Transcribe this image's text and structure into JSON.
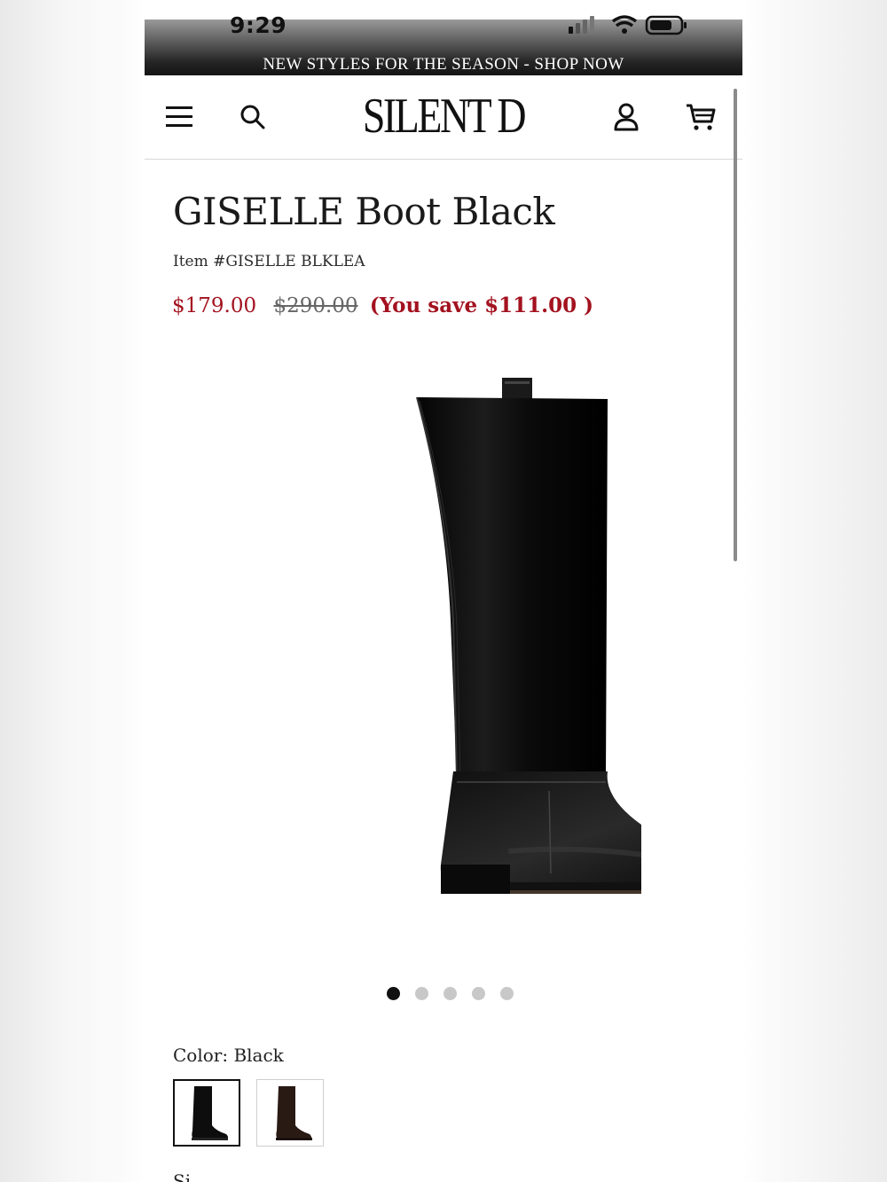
{
  "status_bar": {
    "time": "9:29"
  },
  "promo_banner": {
    "text": "NEW STYLES FOR THE SEASON - SHOP NOW"
  },
  "header": {
    "logo": "SILENT D",
    "icons": [
      "menu-icon",
      "search-icon",
      "account-icon",
      "cart-icon"
    ]
  },
  "product": {
    "title": "GISELLE Boot Black",
    "sku": "Item #GISELLE BLKLEA",
    "sale_price": "$179.00",
    "original_price": "$290.00",
    "savings": "(You save $111.00 )",
    "image_count": 5,
    "active_image_index": 0,
    "color_label": "Color: Black",
    "colors": [
      {
        "name": "Black",
        "hex": "#0d0d0d",
        "selected": true
      },
      {
        "name": "Brown",
        "hex": "#2a1a14",
        "selected": false
      }
    ],
    "size_label": "Si"
  },
  "colors": {
    "sale": "#a3121f",
    "text": "#1a1a1a"
  }
}
